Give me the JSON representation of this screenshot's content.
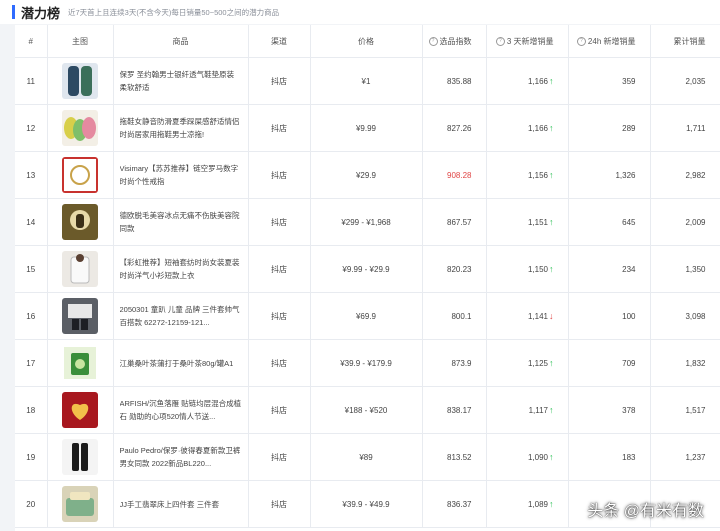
{
  "header": {
    "title": "潜力榜",
    "subtitle": "近7天首上且连续3天(不含今天)每日销量50~500之间的潜力商品"
  },
  "columns": {
    "rank": "#",
    "image": "主图",
    "product": "商品",
    "channel": "渠道",
    "price": "价格",
    "index": "选品指数",
    "new3d": "3 天新增销量",
    "new24h": "24h 新增销量",
    "total": "累计销量"
  },
  "rows": [
    {
      "rank": "11",
      "name": "保罗 圣约翰男士银纤透气鞋垫原装柔软舒适",
      "channel": "抖店",
      "price": "¥1",
      "index": "835.88",
      "new3d": "1,166",
      "trend": "up",
      "new24h": "359",
      "total": "2,035"
    },
    {
      "rank": "12",
      "name": "拖鞋女静音防滑夏季踩屎感舒适情侣时尚居家用拖鞋男士凉拖!",
      "channel": "抖店",
      "price": "¥9.99",
      "index": "827.26",
      "new3d": "1,166",
      "trend": "up",
      "new24h": "289",
      "total": "1,711"
    },
    {
      "rank": "13",
      "name": "Visimary【苏苏推荐】链空罗马数字时尚个性戒指",
      "channel": "抖店",
      "price": "¥29.9",
      "index": "908.28",
      "index_hot": true,
      "new3d": "1,156",
      "trend": "up",
      "new24h": "1,326",
      "total": "2,982"
    },
    {
      "rank": "14",
      "name": "德欧脱毛美容冰点无痛不伤肤美容院同款",
      "channel": "抖店",
      "price": "¥299 - ¥1,968",
      "index": "867.57",
      "new3d": "1,151",
      "trend": "up",
      "new24h": "645",
      "total": "2,009"
    },
    {
      "rank": "15",
      "name": "【彩虹推荐】短袖套纺时尚女装夏装时尚洋气小衫短款上衣",
      "channel": "抖店",
      "price": "¥9.99 - ¥29.9",
      "index": "820.23",
      "new3d": "1,150",
      "trend": "up",
      "new24h": "234",
      "total": "1,350"
    },
    {
      "rank": "16",
      "name": "2050301 童趴 儿童 品牌 三件套帅气 百搭款 62272-12159-121...",
      "channel": "抖店",
      "price": "¥69.9",
      "index": "800.1",
      "new3d": "1,141",
      "trend": "down",
      "new24h": "100",
      "total": "3,098"
    },
    {
      "rank": "17",
      "name": "江巢桑叶茶蒲打于桑叶茶80g/罐A1",
      "channel": "抖店",
      "price": "¥39.9 - ¥179.9",
      "index": "873.9",
      "new3d": "1,125",
      "trend": "up",
      "new24h": "709",
      "total": "1,832"
    },
    {
      "rank": "18",
      "name": "ARFISH/沉鱼落雁 贴链均层混合成植石 勋助的心项520情人节送...",
      "channel": "抖店",
      "price": "¥188 - ¥520",
      "index": "838.17",
      "new3d": "1,117",
      "trend": "up",
      "new24h": "378",
      "total": "1,517"
    },
    {
      "rank": "19",
      "name": "Paulo Pedro/保罗·彼得春夏新款卫裤 男女同款 2022新品BL220...",
      "channel": "抖店",
      "price": "¥89",
      "index": "813.52",
      "new3d": "1,090",
      "trend": "up",
      "new24h": "183",
      "total": "1,237"
    },
    {
      "rank": "20",
      "name": "JJ手工翡翠床上四件套 三件套",
      "channel": "抖店",
      "price": "¥39.9 - ¥49.9",
      "index": "836.37",
      "new3d": "1,089",
      "trend": "up",
      "new24h": "",
      "total": ""
    }
  ],
  "watermark": "头条 @有米有数",
  "colors": {
    "accent": "#2f6bff",
    "up": "#2bbf55",
    "down": "#e04646",
    "hot": "#e04646"
  },
  "icons": {
    "info": "question-circle-icon",
    "up": "arrow-up-icon",
    "down": "arrow-down-icon"
  }
}
